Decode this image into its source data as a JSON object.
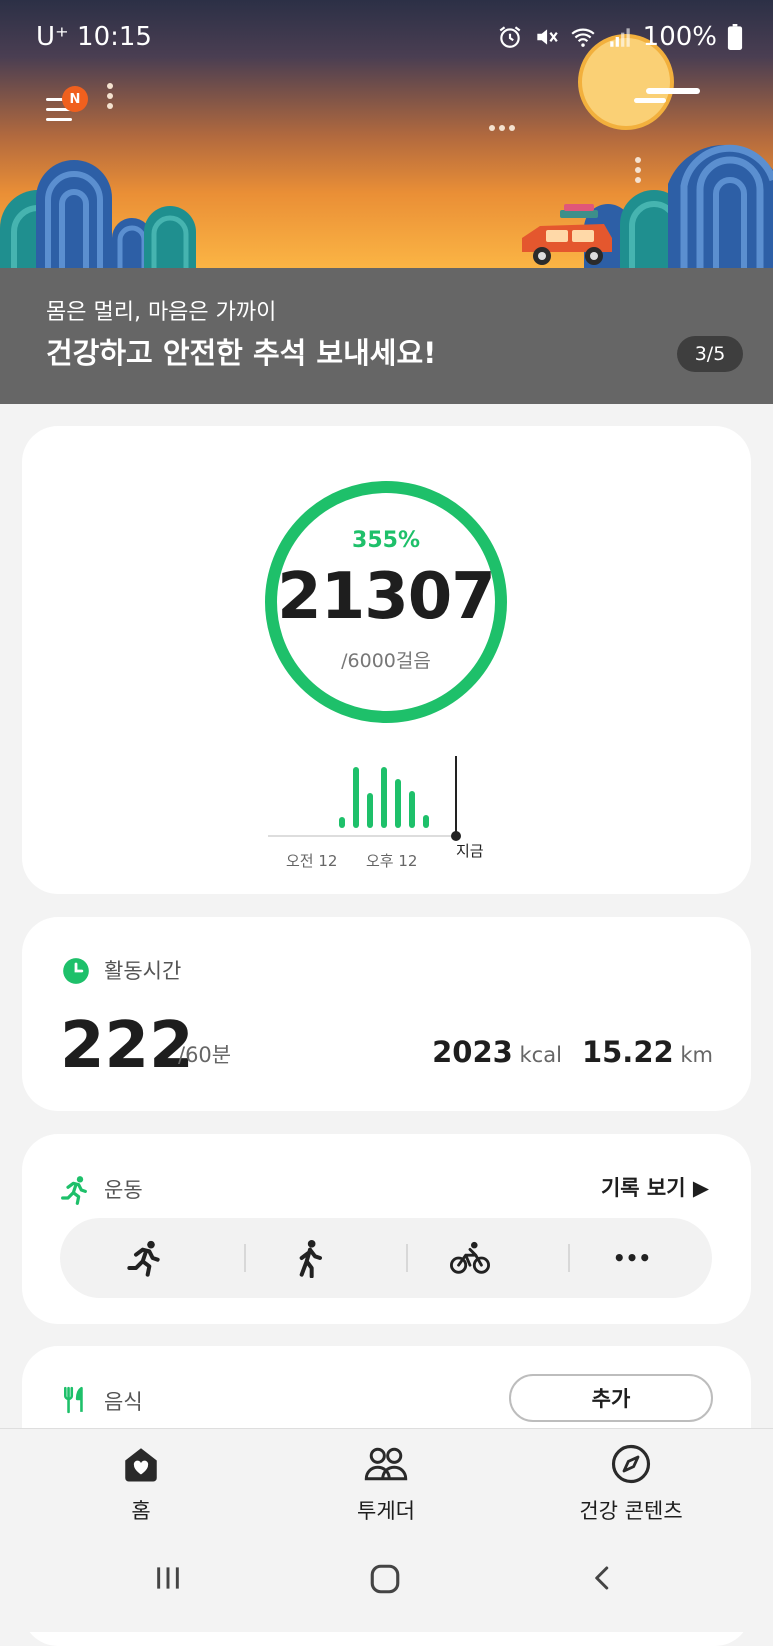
{
  "status_bar": {
    "carrier": "U⁺",
    "time": "10:15",
    "battery": "100%"
  },
  "banner": {
    "menu_badge": "N",
    "subtitle": "몸은 멀리, 마음은 가까이",
    "title": "건강하고 안전한 추석 보내세요!",
    "page_indicator": "3/5"
  },
  "steps": {
    "percent": "355%",
    "count": "21307",
    "goal": "/6000걸음",
    "progress_fraction": 1.0,
    "ring_color": "#1ec06a",
    "chart_labels": {
      "am": "오전 12",
      "pm": "오후 12",
      "now": "지금"
    }
  },
  "activity": {
    "title": "활동시간",
    "minutes": "222",
    "goal": "/60분",
    "kcal_value": "2023",
    "kcal_unit": "kcal",
    "km_value": "15.22",
    "km_unit": "km"
  },
  "exercise": {
    "title": "운동",
    "history_link": "기록 보기 ▶",
    "items": [
      "running-icon",
      "walking-icon",
      "cycling-icon",
      "more-icon"
    ],
    "more_label": "•••"
  },
  "food": {
    "title": "음식",
    "add_label": "추가"
  },
  "bottom_nav": [
    {
      "label": "홈",
      "icon": "home-heart-icon"
    },
    {
      "label": "투게더",
      "icon": "people-icon"
    },
    {
      "label": "건강 콘텐츠",
      "icon": "compass-icon"
    }
  ],
  "accent_color": "#1ec06a"
}
